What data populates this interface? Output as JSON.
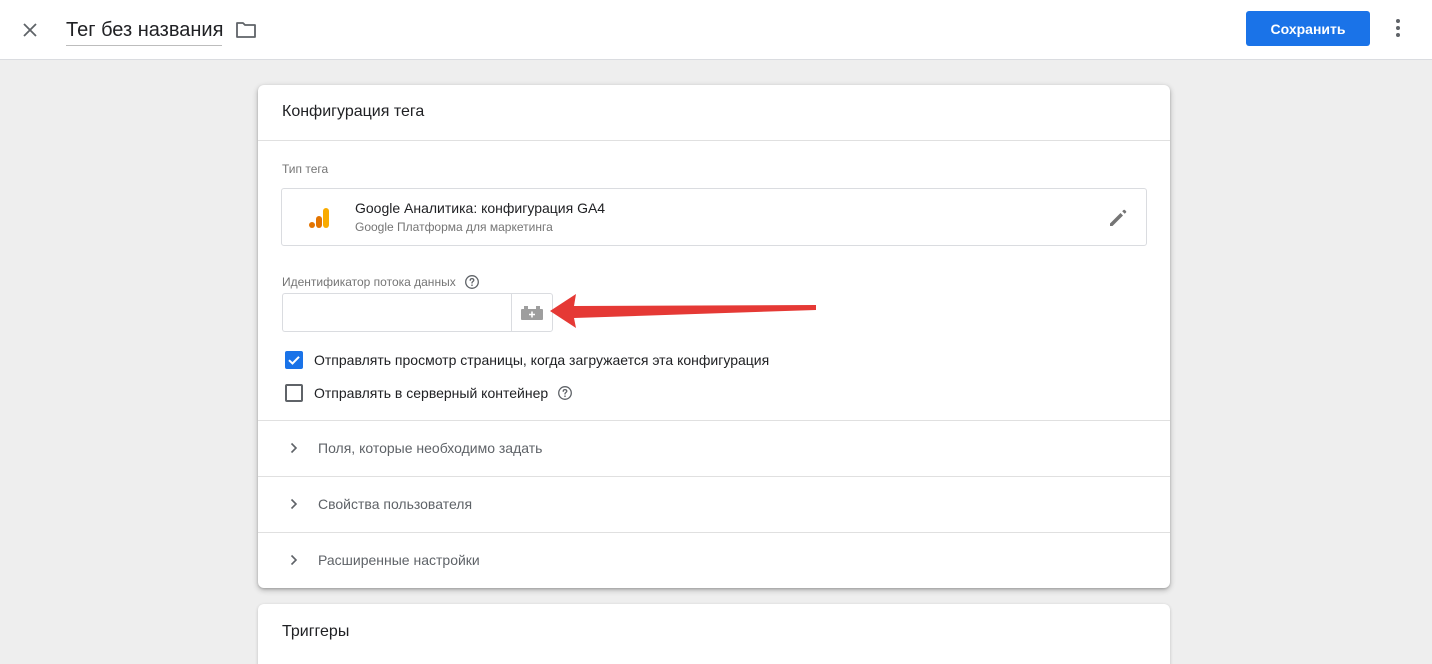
{
  "header": {
    "tag_title": "Тег без названия",
    "save_label": "Сохранить"
  },
  "config": {
    "title": "Конфигурация тега",
    "tag_type_label": "Тип тега",
    "tag_type_name": "Google Аналитика: конфигурация GA4",
    "tag_type_sub": "Google Платформа для маркетинга",
    "stream_label": "Идентификатор потока данных",
    "stream_value": "",
    "checkboxes": [
      {
        "label": "Отправлять просмотр страницы, когда загружается эта конфигурация",
        "checked": true
      },
      {
        "label": "Отправлять в серверный контейнер",
        "checked": false
      }
    ],
    "sections": [
      {
        "label": "Поля, которые необходимо задать"
      },
      {
        "label": "Свойства пользователя"
      },
      {
        "label": "Расширенные настройки"
      }
    ]
  },
  "triggers": {
    "title": "Триггеры"
  },
  "colors": {
    "accent": "#1a73e8",
    "annotation_arrow": "#e53935",
    "ga_orange_dark": "#e37400",
    "ga_orange_light": "#f9ab00"
  },
  "icons": {
    "close": "close-icon",
    "folder": "folder-icon",
    "more": "more-vert-icon",
    "analytics": "google-analytics-icon",
    "edit": "pencil-icon",
    "help": "help-icon",
    "variable": "variable-brick-icon",
    "chevron": "chevron-right-icon",
    "check": "check-icon"
  }
}
